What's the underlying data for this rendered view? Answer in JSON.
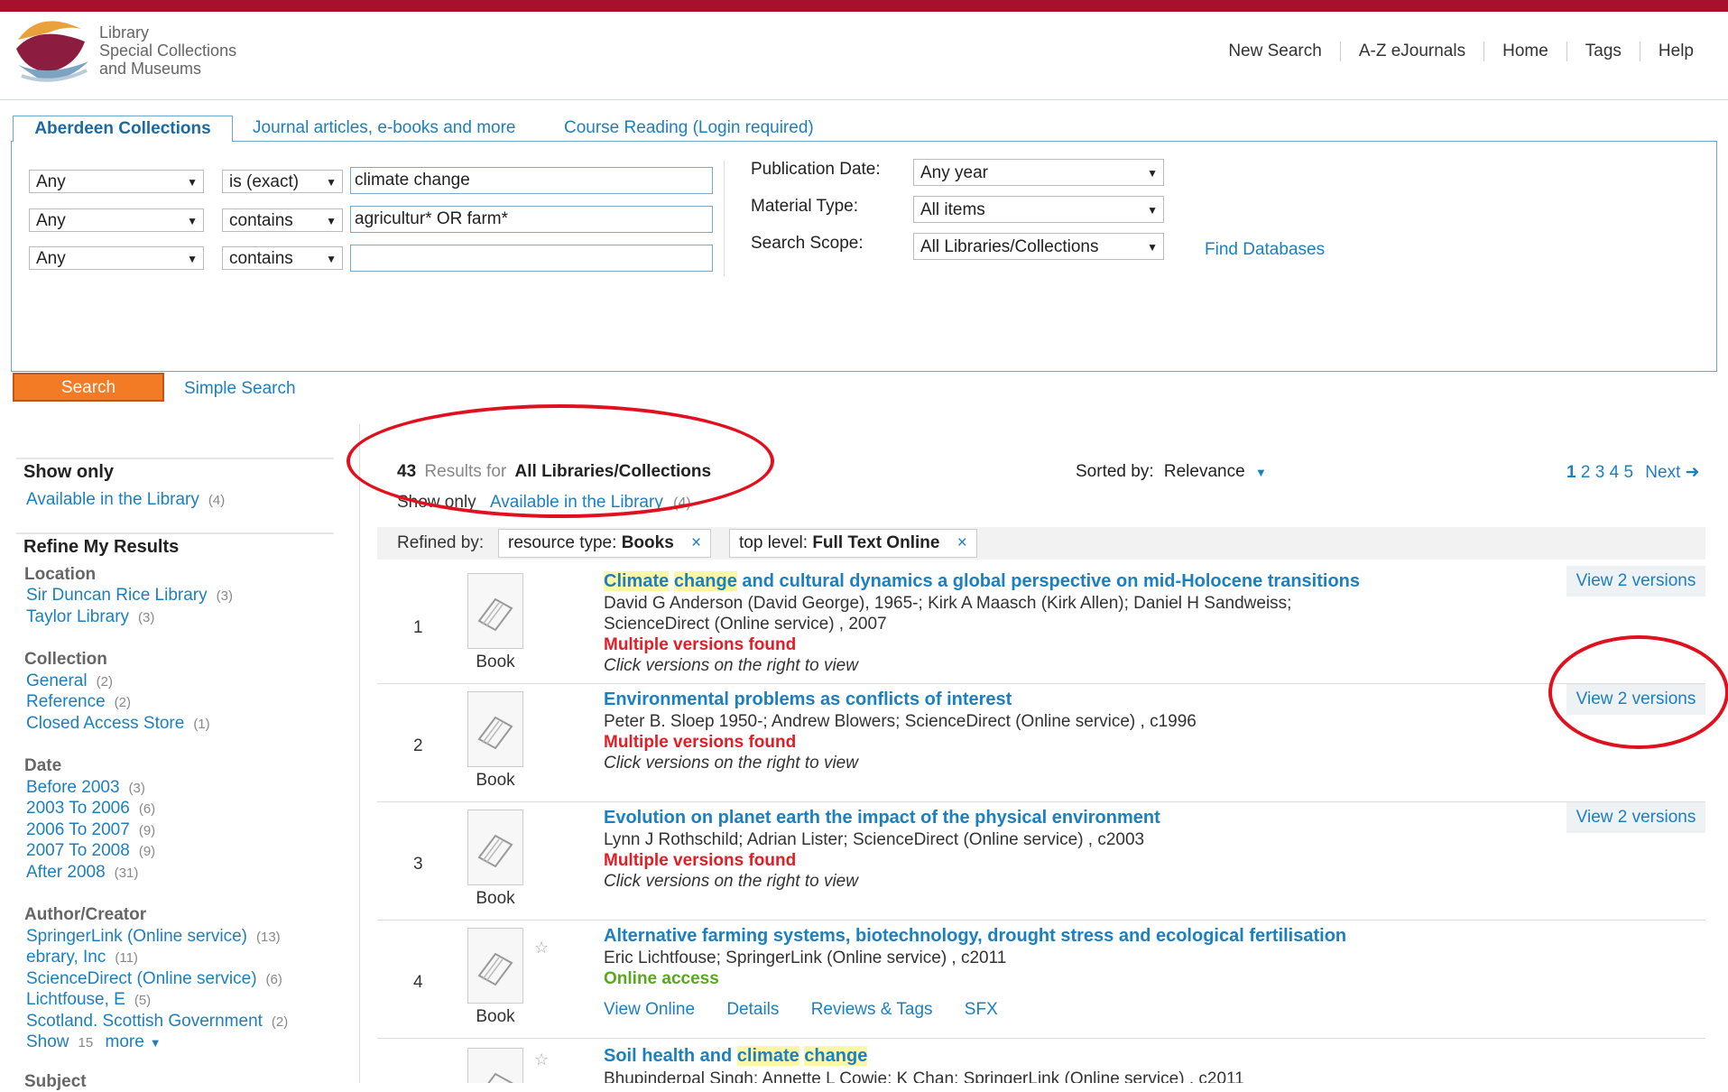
{
  "header": {
    "logo_lines": [
      "Library",
      "Special Collections",
      "and Museums"
    ],
    "nav": [
      "New Search",
      "A-Z eJournals",
      "Home",
      "Tags",
      "Help"
    ]
  },
  "tabs": [
    {
      "label": "Aberdeen Collections",
      "active": true
    },
    {
      "label": "Journal articles, e-books and more",
      "active": false
    },
    {
      "label": "Course Reading (Login required)",
      "active": false
    }
  ],
  "search_rows": [
    {
      "field": "Any",
      "operator": "is (exact)",
      "value": "climate change"
    },
    {
      "field": "Any",
      "operator": "contains",
      "value": "agricultur* OR farm*"
    },
    {
      "field": "Any",
      "operator": "contains",
      "value": ""
    }
  ],
  "filters": {
    "publication_date": {
      "label": "Publication Date:",
      "value": "Any year"
    },
    "material_type": {
      "label": "Material Type:",
      "value": "All items"
    },
    "search_scope": {
      "label": "Search Scope:",
      "value": "All Libraries/Collections"
    },
    "find_databases": "Find Databases"
  },
  "buttons": {
    "search": "Search",
    "simple_search": "Simple Search"
  },
  "results_header": {
    "count": "43",
    "results_for": "Results for",
    "scope": "All Libraries/Collections",
    "show_only": "Show only",
    "available": "Available in the Library",
    "available_count": "(4)",
    "sorted_by_label": "Sorted by:",
    "sorted_by_value": "Relevance",
    "pages": [
      "1",
      "2",
      "3",
      "4",
      "5"
    ],
    "next": "Next"
  },
  "refined_by": {
    "label": "Refined by:",
    "chips": [
      {
        "key": "resource type:",
        "value": "Books"
      },
      {
        "key": "top level:",
        "value": "Full Text Online"
      }
    ]
  },
  "sidebar": {
    "show_only_title": "Show only",
    "show_only_item": {
      "label": "Available in the Library",
      "count": "(4)"
    },
    "refine_title": "Refine My Results",
    "location_title": "Location",
    "location": [
      {
        "label": "Sir Duncan Rice Library",
        "count": "(3)"
      },
      {
        "label": "Taylor Library",
        "count": "(3)"
      }
    ],
    "collection_title": "Collection",
    "collection": [
      {
        "label": "General",
        "count": "(2)"
      },
      {
        "label": "Reference",
        "count": "(2)"
      },
      {
        "label": "Closed Access Store",
        "count": "(1)"
      }
    ],
    "date_title": "Date",
    "date": [
      {
        "label": "Before 2003",
        "count": "(3)"
      },
      {
        "label": "2003 To 2006",
        "count": "(6)"
      },
      {
        "label": "2006 To 2007",
        "count": "(9)"
      },
      {
        "label": "2007 To 2008",
        "count": "(9)"
      },
      {
        "label": "After 2008",
        "count": "(31)"
      }
    ],
    "author_title": "Author/Creator",
    "author": [
      {
        "label": "SpringerLink (Online service)",
        "count": "(13)"
      },
      {
        "label": "ebrary, Inc",
        "count": "(11)"
      },
      {
        "label": "ScienceDirect (Online service)",
        "count": "(6)"
      },
      {
        "label": "Lichtfouse, E",
        "count": "(5)"
      },
      {
        "label": "Scotland. Scottish Government",
        "count": "(2)"
      }
    ],
    "show_more": {
      "show": "Show",
      "count": "15",
      "more": "more"
    },
    "subject_title": "Subject"
  },
  "results": [
    {
      "num": "1",
      "type": "Book",
      "title_pre": "",
      "title_hl1": "Climate",
      "title_mid": " ",
      "title_hl2": "change",
      "title_post": " and cultural dynamics a global perspective on mid-Holocene transitions",
      "authors": "David G Anderson (David George), 1965-; Kirk A Maasch (Kirk Allen); Daniel H Sandweiss;",
      "source": "ScienceDirect (Online service) , 2007",
      "status": "Multiple versions found",
      "hint": "Click versions on the right to view",
      "versions": "View 2 versions"
    },
    {
      "num": "2",
      "type": "Book",
      "title": "Environmental problems as conflicts of interest",
      "authors": "Peter B. Sloep 1950-; Andrew Blowers; ScienceDirect (Online service) , c1996",
      "status": "Multiple versions found",
      "hint": "Click versions on the right to view",
      "versions": "View 2 versions"
    },
    {
      "num": "3",
      "type": "Book",
      "title": "Evolution on planet earth the impact of the physical environment",
      "authors": "Lynn J Rothschild; Adrian Lister; ScienceDirect (Online service) , c2003",
      "status": "Multiple versions found",
      "hint": "Click versions on the right to view",
      "versions": "View 2 versions"
    },
    {
      "num": "4",
      "type": "Book",
      "title": "Alternative farming systems, biotechnology, drought stress and ecological fertilisation",
      "authors": "Eric Lichtfouse; SpringerLink (Online service) , c2011",
      "status": "Online access",
      "actions": [
        "View Online",
        "Details",
        "Reviews & Tags",
        "SFX"
      ]
    },
    {
      "num": "",
      "type": "",
      "title_pre": "Soil health and ",
      "title_hl1": "climate",
      "title_mid": " ",
      "title_hl2": "change",
      "authors": "Bhupinderpal Singh; Annette L Cowie; K Chan; SpringerLink (Online service) , c2011"
    }
  ],
  "colors": {
    "topbar": "#a8102b",
    "link": "#1c7fbf",
    "search_button": "#f47b26",
    "status_red": "#e01e26",
    "status_green": "#5aa81f",
    "annotation": "#e0101e"
  },
  "icons": {
    "dropdown": "chevron-down-icon",
    "book": "book-icon",
    "star": "star-icon",
    "remove": "close-icon",
    "next": "arrow-right-icon"
  }
}
